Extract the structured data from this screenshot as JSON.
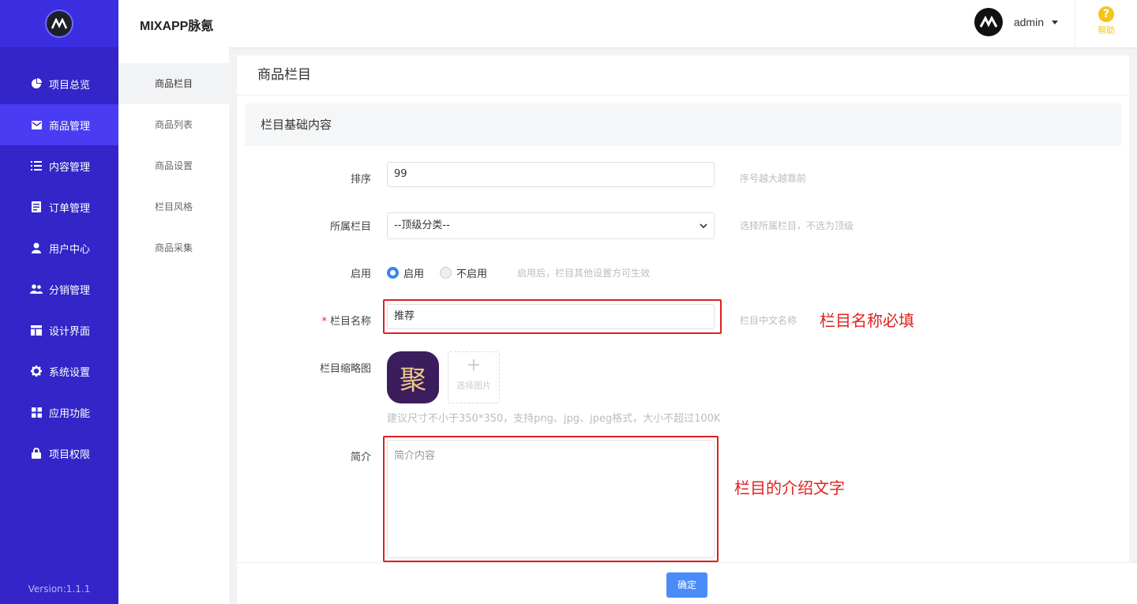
{
  "sidebar": {
    "version": "Version:1.1.1",
    "items": [
      {
        "label": "项目总览",
        "icon": "pie-chart-icon"
      },
      {
        "label": "商品管理",
        "icon": "mail-icon"
      },
      {
        "label": "内容管理",
        "icon": "list-icon"
      },
      {
        "label": "订单管理",
        "icon": "document-icon"
      },
      {
        "label": "用户中心",
        "icon": "user-icon"
      },
      {
        "label": "分销管理",
        "icon": "users-icon"
      },
      {
        "label": "设计界面",
        "icon": "layout-icon"
      },
      {
        "label": "系统设置",
        "icon": "gear-icon"
      },
      {
        "label": "应用功能",
        "icon": "grid-icon"
      },
      {
        "label": "项目权限",
        "icon": "lock-icon"
      }
    ]
  },
  "header": {
    "brand": "MIXAPP脉氪",
    "username": "admin",
    "help_label": "帮助"
  },
  "subnav": {
    "items": [
      "商品栏目",
      "商品列表",
      "商品设置",
      "栏目风格",
      "商品采集"
    ]
  },
  "main": {
    "title": "商品栏目",
    "section_title": "栏目基础内容",
    "sort": {
      "label": "排序",
      "value": "99",
      "hint": "序号越大越靠前"
    },
    "parent": {
      "label": "所属栏目",
      "value": "--顶级分类--",
      "hint": "选择所属栏目，不选为顶级"
    },
    "enable": {
      "label": "启用",
      "on_label": "启用",
      "off_label": "不启用",
      "hint": "启用后，栏目其他设置方可生效"
    },
    "name": {
      "label": "栏目名称",
      "required": "*",
      "value": "推荐",
      "hint": "栏目中文名称",
      "annotation": "栏目名称必填"
    },
    "thumb": {
      "label": "栏目缩略图",
      "char": "聚",
      "upload_label": "选择图片",
      "hint": "建议尺寸不小于350*350，支持png、jpg、jpeg格式，大小不超过100K"
    },
    "intro": {
      "label": "简介",
      "placeholder": "简介内容",
      "annotation": "栏目的介绍文字"
    }
  },
  "footer": {
    "confirm_label": "确定"
  },
  "colors": {
    "sidebar_bg": "#3325c8",
    "accent": "#4a8cf7",
    "annotation": "#e02020",
    "help": "#f5c518"
  }
}
